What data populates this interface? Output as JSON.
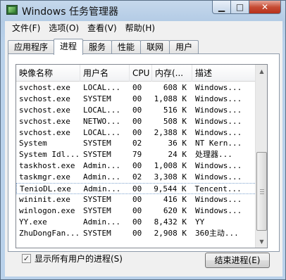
{
  "window": {
    "title": "Windows 任务管理器"
  },
  "menubar": [
    "文件(F)",
    "选项(O)",
    "查看(V)",
    "帮助(H)"
  ],
  "tabs": [
    "应用程序",
    "进程",
    "服务",
    "性能",
    "联网",
    "用户"
  ],
  "active_tab": "进程",
  "columns": [
    "映像名称",
    "用户名",
    "CPU",
    "内存(...",
    "描述"
  ],
  "processes": [
    {
      "name": "svchost.exe",
      "user": "LOCAL...",
      "cpu": "00",
      "mem": "608 K",
      "desc": "Windows..."
    },
    {
      "name": "svchost.exe",
      "user": "SYSTEM",
      "cpu": "00",
      "mem": "1,088 K",
      "desc": "Windows..."
    },
    {
      "name": "svchost.exe",
      "user": "LOCAL...",
      "cpu": "00",
      "mem": "516 K",
      "desc": "Windows..."
    },
    {
      "name": "svchost.exe",
      "user": "NETWO...",
      "cpu": "00",
      "mem": "508 K",
      "desc": "Windows..."
    },
    {
      "name": "svchost.exe",
      "user": "LOCAL...",
      "cpu": "00",
      "mem": "2,388 K",
      "desc": "Windows..."
    },
    {
      "name": "System",
      "user": "SYSTEM",
      "cpu": "02",
      "mem": "36 K",
      "desc": "NT Kern..."
    },
    {
      "name": "System Idl...",
      "user": "SYSTEM",
      "cpu": "79",
      "mem": "24 K",
      "desc": "处理器..."
    },
    {
      "name": "taskhost.exe",
      "user": "Admin...",
      "cpu": "00",
      "mem": "1,008 K",
      "desc": "Windows..."
    },
    {
      "name": "taskmgr.exe",
      "user": "Admin...",
      "cpu": "02",
      "mem": "3,308 K",
      "desc": "Windows..."
    },
    {
      "name": "TenioDL.exe",
      "user": "Admin...",
      "cpu": "00",
      "mem": "9,544 K",
      "desc": "Tencent..."
    },
    {
      "name": "wininit.exe",
      "user": "SYSTEM",
      "cpu": "00",
      "mem": "416 K",
      "desc": "Windows..."
    },
    {
      "name": "winlogon.exe",
      "user": "SYSTEM",
      "cpu": "00",
      "mem": "620 K",
      "desc": "Windows..."
    },
    {
      "name": "YY.exe",
      "user": "Admin...",
      "cpu": "00",
      "mem": "8,432 K",
      "desc": "YY"
    },
    {
      "name": "ZhuDongFan...",
      "user": "SYSTEM",
      "cpu": "00",
      "mem": "2,908 K",
      "desc": "360主动..."
    }
  ],
  "selected_index": 9,
  "scroll_position": 0.95,
  "show_all_label": "显示所有用户的进程(S)",
  "show_all_checked": true,
  "end_process_label": "结束进程(E)",
  "icons": {
    "app": "task-manager-icon",
    "check": "✓",
    "up": "▲",
    "down": "▼"
  }
}
